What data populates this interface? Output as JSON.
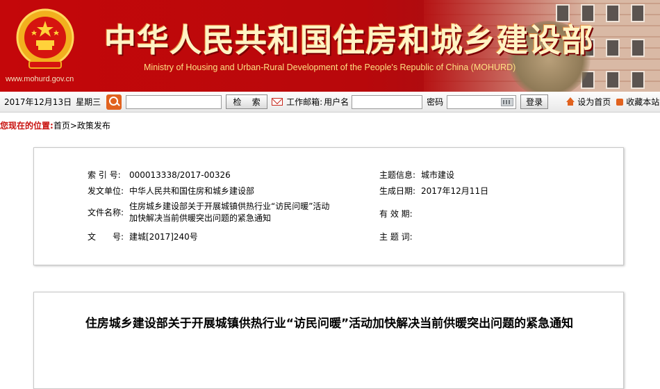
{
  "banner": {
    "site_url": "www.mohurd.gov.cn",
    "title_cn": "中华人民共和国住房和城乡建设部",
    "title_en": "Ministry of Housing and Urban-Rural Development of the People's Republic of China (MOHURD)"
  },
  "toolbar": {
    "date": "2017年12月13日",
    "weekday": "星期三",
    "search_value": "",
    "search_button": "检 索",
    "mail_label": "工作邮箱:",
    "user_label": "用户名",
    "user_value": "",
    "password_label": "密码",
    "password_value": "",
    "login_button": "登录",
    "set_home": "设为首页",
    "bookmark": "收藏本站"
  },
  "breadcrumb": {
    "label": "您现在的位置:",
    "home": "首页",
    "separator": ">",
    "current": "政策发布"
  },
  "info": {
    "index_no_label": "索 引 号:",
    "index_no": "000013338/2017-00326",
    "topic_label": "主题信息:",
    "topic": "城市建设",
    "issuer_label": "发文单位:",
    "issuer": "中华人民共和国住房和城乡建设部",
    "date_label": "生成日期:",
    "date": "2017年12月11日",
    "doc_name_label": "文件名称:",
    "doc_name": "住房城乡建设部关于开展城镇供热行业“访民问暖”活动加快解决当前供暖突出问题的紧急通知",
    "validity_label": "有 效 期:",
    "validity": "",
    "doc_no_label": "文　　号:",
    "doc_no": "建城[2017]240号",
    "keywords_label": "主 题 词:",
    "keywords": ""
  },
  "article": {
    "title": "住房城乡建设部关于开展城镇供热行业“访民问暖”活动加快解决当前供暖突出问题的紧急通知"
  },
  "colors": {
    "banner_red": "#c4070a",
    "title_gold": "#fff3c4",
    "breadcrumb_red": "#c8120f",
    "icon_orange": "#e1621f"
  }
}
